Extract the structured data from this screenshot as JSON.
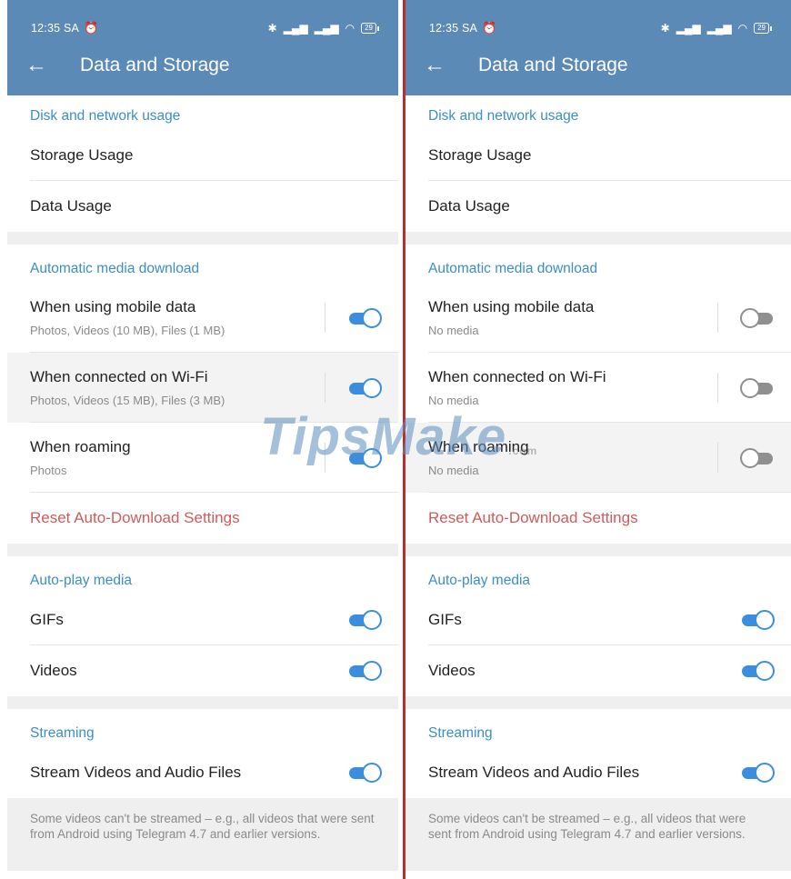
{
  "status_bar": {
    "time": "12:35 SA",
    "alarm_icon": "alarm-clock-icon",
    "battery": "29"
  },
  "app_bar": {
    "title": "Data and Storage",
    "back_icon": "arrow-back-icon"
  },
  "sections": {
    "disk": {
      "header": "Disk and network usage",
      "storage_usage": "Storage Usage",
      "data_usage": "Data Usage"
    },
    "auto_download": {
      "header": "Automatic media download",
      "mobile_label": "When using mobile data",
      "wifi_label": "When connected on Wi-Fi",
      "roaming_label": "When roaming",
      "reset": "Reset Auto-Download Settings"
    },
    "autoplay": {
      "header": "Auto-play media",
      "gifs": "GIFs",
      "videos": "Videos"
    },
    "streaming": {
      "header": "Streaming",
      "stream_label": "Stream Videos and Audio Files",
      "footer": "Some videos can't be streamed – e.g., all videos that were sent from Android using Telegram 4.7 and earlier versions."
    }
  },
  "left": {
    "mobile_sub": "Photos, Videos (10 MB), Files (1 MB)",
    "wifi_sub": "Photos, Videos (15 MB), Files (3 MB)",
    "roaming_sub": "Photos",
    "toggles": {
      "mobile": true,
      "wifi": true,
      "roaming": true,
      "gifs": true,
      "videos": true,
      "stream": true
    }
  },
  "right": {
    "mobile_sub": "No media",
    "wifi_sub": "No media",
    "roaming_sub": "No media",
    "toggles": {
      "mobile": false,
      "wifi": false,
      "roaming": false,
      "gifs": true,
      "videos": true,
      "stream": true
    }
  },
  "watermark": {
    "text": "TipsMake",
    "suffix": ".com"
  },
  "colors": {
    "app_bar": "#5b8ab6",
    "accent": "#3b8ede",
    "section_header": "#3c8ec5",
    "reset": "#d05b5b",
    "divider": "#c4282b"
  }
}
